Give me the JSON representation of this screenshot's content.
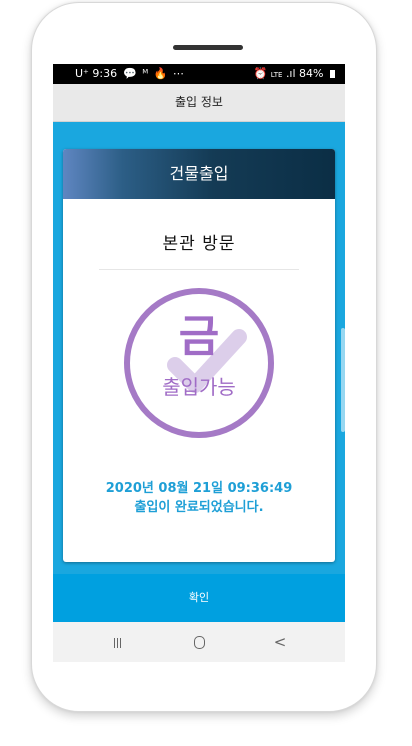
{
  "status_bar": {
    "carrier": "U⁺",
    "time": "9:36",
    "notification_icons": "💬 ᴹ 🔥 ⋯",
    "signal_text": "LTE",
    "battery": "84%"
  },
  "app_bar": {
    "title": "출입 정보"
  },
  "card": {
    "header": "건물출입",
    "place": "본관 방문",
    "stamp_char": "금",
    "stamp_label": "출입가능",
    "datetime": "2020년 08월 21일 09:36:49",
    "complete_message": "출입이 완료되었습니다."
  },
  "confirm_button": {
    "label": "확인"
  },
  "nav_bar": {
    "recent_icon": "recent-apps-icon",
    "home_icon": "home-icon",
    "back_symbol": "<"
  },
  "colors": {
    "content_bg": "#1aa7df",
    "confirm_bg": "#00a0e0",
    "stamp_purple": "#a06cc6",
    "datetime_blue": "#1e9fd6"
  }
}
